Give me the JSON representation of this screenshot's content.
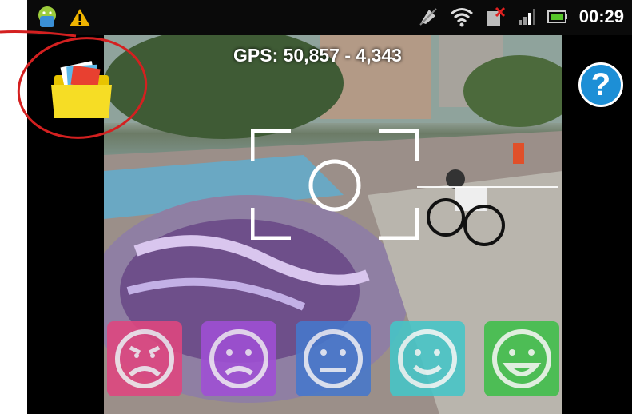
{
  "status_bar": {
    "time": "00:29",
    "icons": [
      "android-icon",
      "warning-icon",
      "gps-off-icon",
      "wifi-icon",
      "sim-error-icon",
      "signal-icon",
      "battery-icon"
    ]
  },
  "overlay": {
    "gps_text": "GPS: 50,857 - 4,343",
    "help_label": "?"
  },
  "moods": [
    {
      "name": "very-sad",
      "color": "#e0467f"
    },
    {
      "name": "sad",
      "color": "#a04fd6"
    },
    {
      "name": "neutral",
      "color": "#4678cc"
    },
    {
      "name": "happy",
      "color": "#45c6c8"
    },
    {
      "name": "very-happy",
      "color": "#3fbf4a"
    }
  ]
}
